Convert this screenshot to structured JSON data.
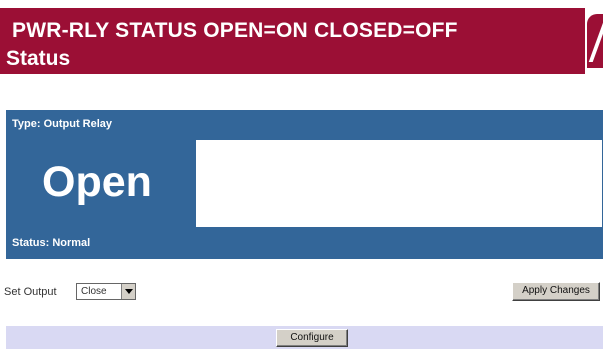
{
  "header": {
    "title": "PWR-RLY STATUS OPEN=ON CLOSED=OFF",
    "subtitle": "Status"
  },
  "relay": {
    "type_text": "Type: Output Relay",
    "state": "Open",
    "status_text": "Status: Normal"
  },
  "controls": {
    "set_output_label": "Set Output",
    "select_value": "Close",
    "apply_label": "Apply Changes",
    "configure_label": "Configure"
  },
  "colors": {
    "header_bg": "#9b0f35",
    "panel_blue": "#336699",
    "footer_bg": "#d9d9f3"
  },
  "icons": {
    "select_arrow": "chevron-down-icon"
  }
}
